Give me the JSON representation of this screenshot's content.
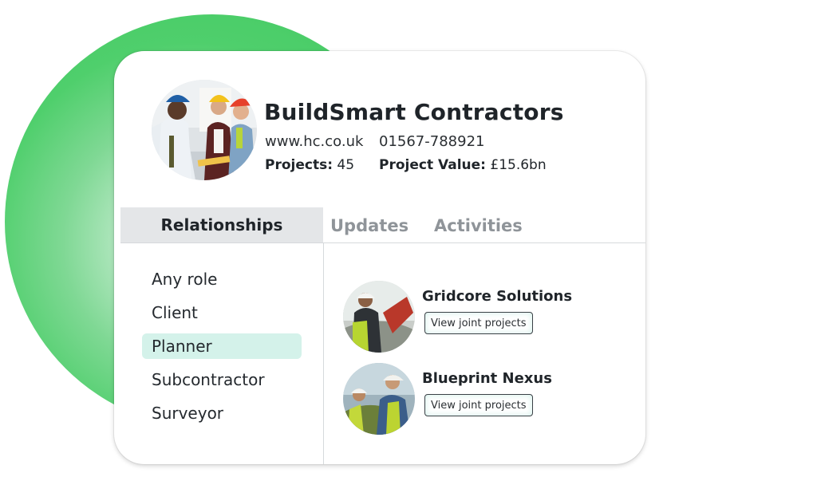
{
  "company": {
    "name": "BuildSmart Contractors",
    "website": "www.hc.co.uk",
    "phone": "01567-788921",
    "projects_label": "Projects:",
    "projects_value": "45",
    "value_label": "Project Value:",
    "value_value": "£15.6bn"
  },
  "tabs": [
    {
      "label": "Relationships",
      "active": true
    },
    {
      "label": "Updates",
      "active": false
    },
    {
      "label": "Activities",
      "active": false
    }
  ],
  "roles": {
    "selected": "Planner",
    "items": [
      "Any role",
      "Client",
      "Planner",
      "Subcontractor",
      "Surveyor"
    ]
  },
  "relationships": [
    {
      "name": "Gridcore Solutions",
      "button": "View joint projects"
    },
    {
      "name": "Blueprint Nexus",
      "button": "View joint projects"
    }
  ],
  "colors": {
    "accent_green": "#4fcf6c",
    "selected_role_bg": "#d4f2ea",
    "active_tab_bg": "#e4e6e8"
  }
}
